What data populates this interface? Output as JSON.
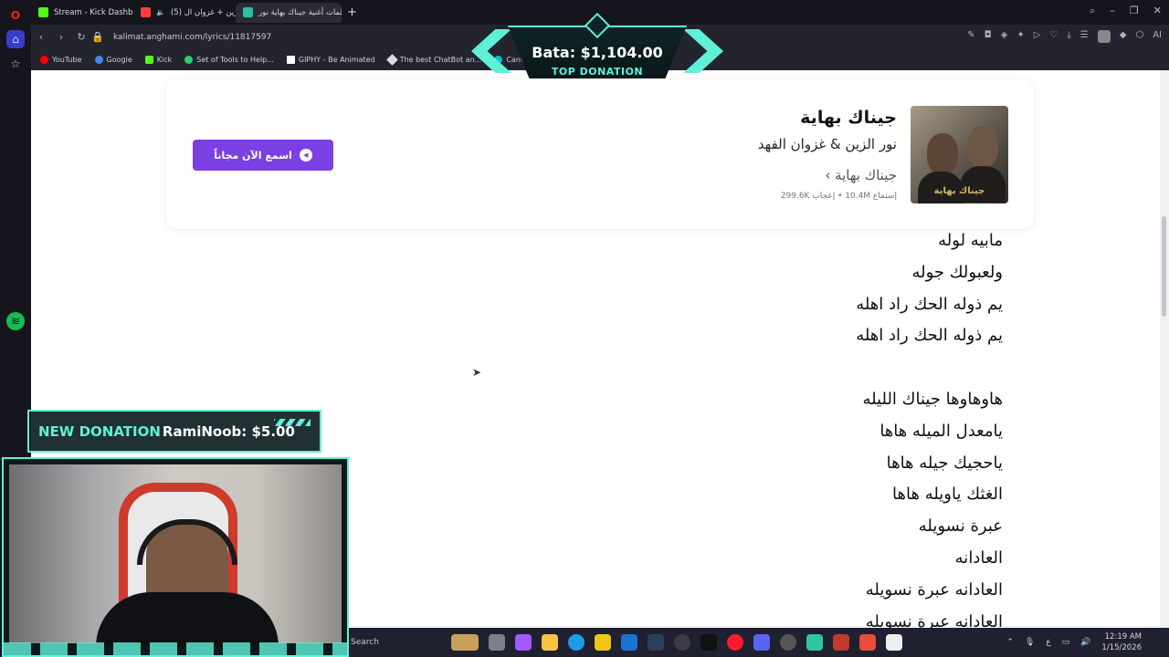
{
  "browser": {
    "tabs": [
      {
        "label": "Stream - Kick Dashboard",
        "color": "#53fc18"
      },
      {
        "label": "(5) نور الزين + غزوان ال",
        "color": "#ff3d3d"
      },
      {
        "label": "كلمات أغنية جيناك بهاية نور",
        "color": "#2bbfa3"
      }
    ],
    "new_tab": "+",
    "url": "kalimat.anghami.com/lyrics/11817597",
    "bookmarks": [
      {
        "label": "YouTube",
        "color": "#ff0000"
      },
      {
        "label": "Google",
        "color": "#4285f4"
      },
      {
        "label": "Kick",
        "color": "#53fc18"
      },
      {
        "label": "Set of Tools to Help...",
        "color": "#2ecc71"
      },
      {
        "label": "GIPHY - Be Animated",
        "color": "#ffffff"
      },
      {
        "label": "The best ChatBot an...",
        "color": "#dddddd"
      },
      {
        "label": "Canva",
        "color": "#00c4cc"
      }
    ],
    "ai_label": "AI"
  },
  "song": {
    "title": "جيناك بهاية",
    "artists": "نور الزين & غزوان الفهد",
    "album": "جيناك بهاية ›",
    "stats": "إستماع 10.4M • إعجاب 299.6K",
    "cover_text": "جيناك بهاية",
    "listen_button": "اسمع الآن مجاناً"
  },
  "lyrics": [
    "مابيه لوله",
    "ولعبولك جوله",
    "يم ذوله الحك راد اهله",
    "يم ذوله الحك راد اهله",
    "",
    "هاوهاوها جيناك الليله",
    "يامعدل الميله هاها",
    "ياحجيك جيله هاها",
    "الغثك ياويله هاها",
    "عبرة نسويله",
    "العادانه",
    "العادانه عبرة نسويله",
    "العادانه عبرة نسويله"
  ],
  "overlay": {
    "top_donation_amount": "Bata: $1,104.00",
    "top_donation_label": "TOP DONATION",
    "new_donation_label": "NEW DONATION",
    "new_donation_text": "RamiNoob: $5.00"
  },
  "taskbar": {
    "search": "Search",
    "time": "12:19 AM",
    "date": "1/15/2026",
    "lang": "ع"
  }
}
